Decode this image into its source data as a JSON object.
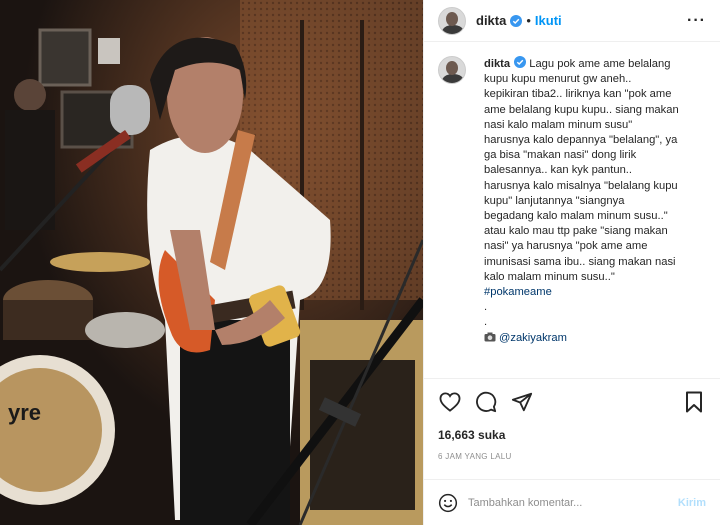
{
  "header": {
    "username": "dikta",
    "follow_label": "Ikuti",
    "separator": "•"
  },
  "caption": {
    "username": "dikta",
    "lines": [
      "Lagu pok ame ame belalang",
      "kupu kupu menurut gw aneh..",
      "kepikiran tiba2.. liriknya kan \"pok ame",
      "ame belalang kupu kupu.. siang makan",
      "nasi kalo malam minum susu\"",
      "harusnya kalo depannya \"belalang\", ya",
      "ga bisa \"makan nasi\" dong lirik",
      "balesannya.. kan kyk pantun..",
      "harusnya kalo misalnya \"belalang kupu",
      "kupu\" lanjutannya \"siangnya",
      "begadang kalo malam minum susu..\"",
      "atau kalo mau ttp pake \"siang makan",
      "nasi\" ya harusnya \"pok ame ame",
      "imunisasi sama ibu.. siang makan nasi",
      "kalo malam minum susu..\""
    ],
    "hashtag": "#pokameame",
    "dot1": ".",
    "dot2": ".",
    "mention": "@zakiyakram"
  },
  "likes": "16,663 suka",
  "time_ago": "6 JAM YANG LALU",
  "comment": {
    "placeholder": "Tambahkan komentar...",
    "post_label": "Kirim"
  },
  "colors": {
    "accent": "#0095f6",
    "verified": "#3897f0",
    "link": "#00376b",
    "post_disabled": "#b2dffc"
  },
  "icons": [
    "verified-badge-icon",
    "more-options-icon",
    "heart-icon",
    "comment-icon",
    "share-icon",
    "bookmark-icon",
    "emoji-icon"
  ]
}
